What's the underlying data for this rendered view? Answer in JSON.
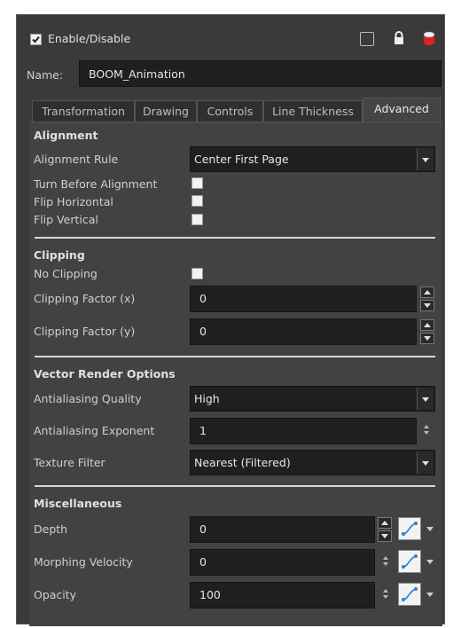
{
  "header": {
    "enable_label": "Enable/Disable",
    "name_label": "Name:",
    "name_value": "BOOM_Animation"
  },
  "tabs": [
    {
      "label": "Transformation"
    },
    {
      "label": "Drawing"
    },
    {
      "label": "Controls"
    },
    {
      "label": "Line Thickness"
    },
    {
      "label": "Advanced"
    }
  ],
  "alignment": {
    "title": "Alignment",
    "rule_label": "Alignment Rule",
    "rule_value": "Center First Page",
    "turn_label": "Turn Before Alignment",
    "flip_h_label": "Flip Horizontal",
    "flip_v_label": "Flip Vertical"
  },
  "clipping": {
    "title": "Clipping",
    "no_clipping_label": "No Clipping",
    "factor_x_label": "Clipping Factor (x)",
    "factor_x_value": "0",
    "factor_y_label": "Clipping Factor (y)",
    "factor_y_value": "0"
  },
  "vector": {
    "title": "Vector Render Options",
    "aa_quality_label": "Antialiasing Quality",
    "aa_quality_value": "High",
    "aa_exponent_label": "Antialiasing Exponent",
    "aa_exponent_value": "1",
    "texture_label": "Texture Filter",
    "texture_value": "Nearest (Filtered)"
  },
  "misc": {
    "title": "Miscellaneous",
    "depth_label": "Depth",
    "depth_value": "0",
    "morph_label": "Morphing Velocity",
    "morph_value": "0",
    "opacity_label": "Opacity",
    "opacity_value": "100"
  },
  "colors": {
    "panel_bg": "#3a3a3a",
    "field_bg": "#1f1f1f",
    "function_curve": "#2a7fd4"
  }
}
